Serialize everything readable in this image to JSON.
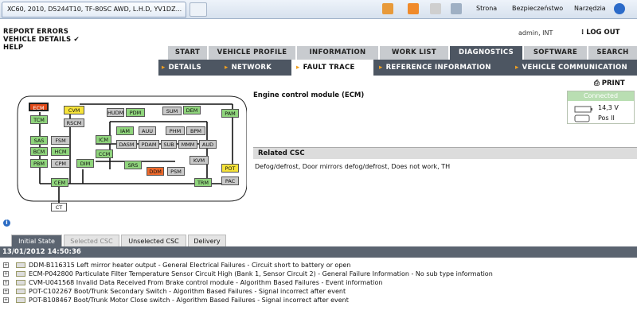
{
  "browser": {
    "tab_title": "XC60, 2010, D5244T10, TF-80SC AWD, L.H.D, YV1DZ...",
    "strona": "Strona",
    "bezpieczenstwo": "Bezpieczeństwo",
    "narzedzia": "Narzędzia"
  },
  "toplinks": [
    "REPORT ERRORS",
    "VEHICLE DETAILS ✔",
    "HELP"
  ],
  "user": "admin, INT",
  "logout": "LOG OUT",
  "tabs": [
    "START",
    "VEHICLE PROFILE",
    "INFORMATION",
    "WORK LIST",
    "DIAGNOSTICS",
    "SOFTWARE",
    "SEARCH"
  ],
  "subtabs": [
    "DETAILS",
    "NETWORK",
    "FAULT TRACE",
    "REFERENCE INFORMATION",
    "VEHICLE COMMUNICATION"
  ],
  "print": "PRINT",
  "module_title": "Engine control module (ECM)",
  "status": {
    "connected": "Connected",
    "voltage": "14,3 V",
    "position": "Pos II"
  },
  "related_header": "Related CSC",
  "related_text": "Defog/defrost, Door mirrors defog/defrost, Does not work, TH",
  "bottom_tabs": [
    "Initial State",
    "Selected CSC",
    "Unselected CSC",
    "Delivery"
  ],
  "date": "13/01/2012 14:50:36",
  "faults": [
    "DDM-B116315 Left mirror heater output - General Electrical Failures - Circuit short to battery or open",
    "ECM-P042800 Particulate Filter Temperature Sensor Circuit High (Bank 1, Sensor Circuit 2) - General Failure Information - No sub type information",
    "CVM-U041568 Invalid Data Received From Brake control module - Algorithm Based Failures - Event information",
    "POT-C102267 Boot/Trunk Secondary Switch - Algorithm Based Failures - Signal incorrect after event",
    "POT-B108467 Boot/Trunk Motor Close switch - Algorithm Based Failures - Signal incorrect after event"
  ],
  "nodes": {
    "ecm": "ECM",
    "cvm": "CVM",
    "tcm": "TCM",
    "rscm": "RSCM",
    "hudm": "HUDM",
    "pdm": "PDM",
    "sum": "SUM",
    "dem": "DEM",
    "pam": "PAM",
    "sas": "SAS",
    "fsm": "FSM",
    "iam": "IAM",
    "auu": "AUU",
    "phm": "PHM",
    "bpm": "BPM",
    "icm": "ICM",
    "bcm": "BCM",
    "hcm": "HCM",
    "dasm": "DASM",
    "pdam": "PDAM",
    "subm": "SUB",
    "mmm": "MMM",
    "aud": "AUD",
    "ccm": "CCM",
    "pbm": "PBM",
    "cpm": "CPM",
    "dim": "DIM",
    "kvm": "KVM",
    "srs": "SRS",
    "ddm": "DDM",
    "psm": "PSM",
    "pot": "POT",
    "cem": "CEM",
    "trm": "TRM",
    "pac": "PAC",
    "ct": "CT"
  }
}
